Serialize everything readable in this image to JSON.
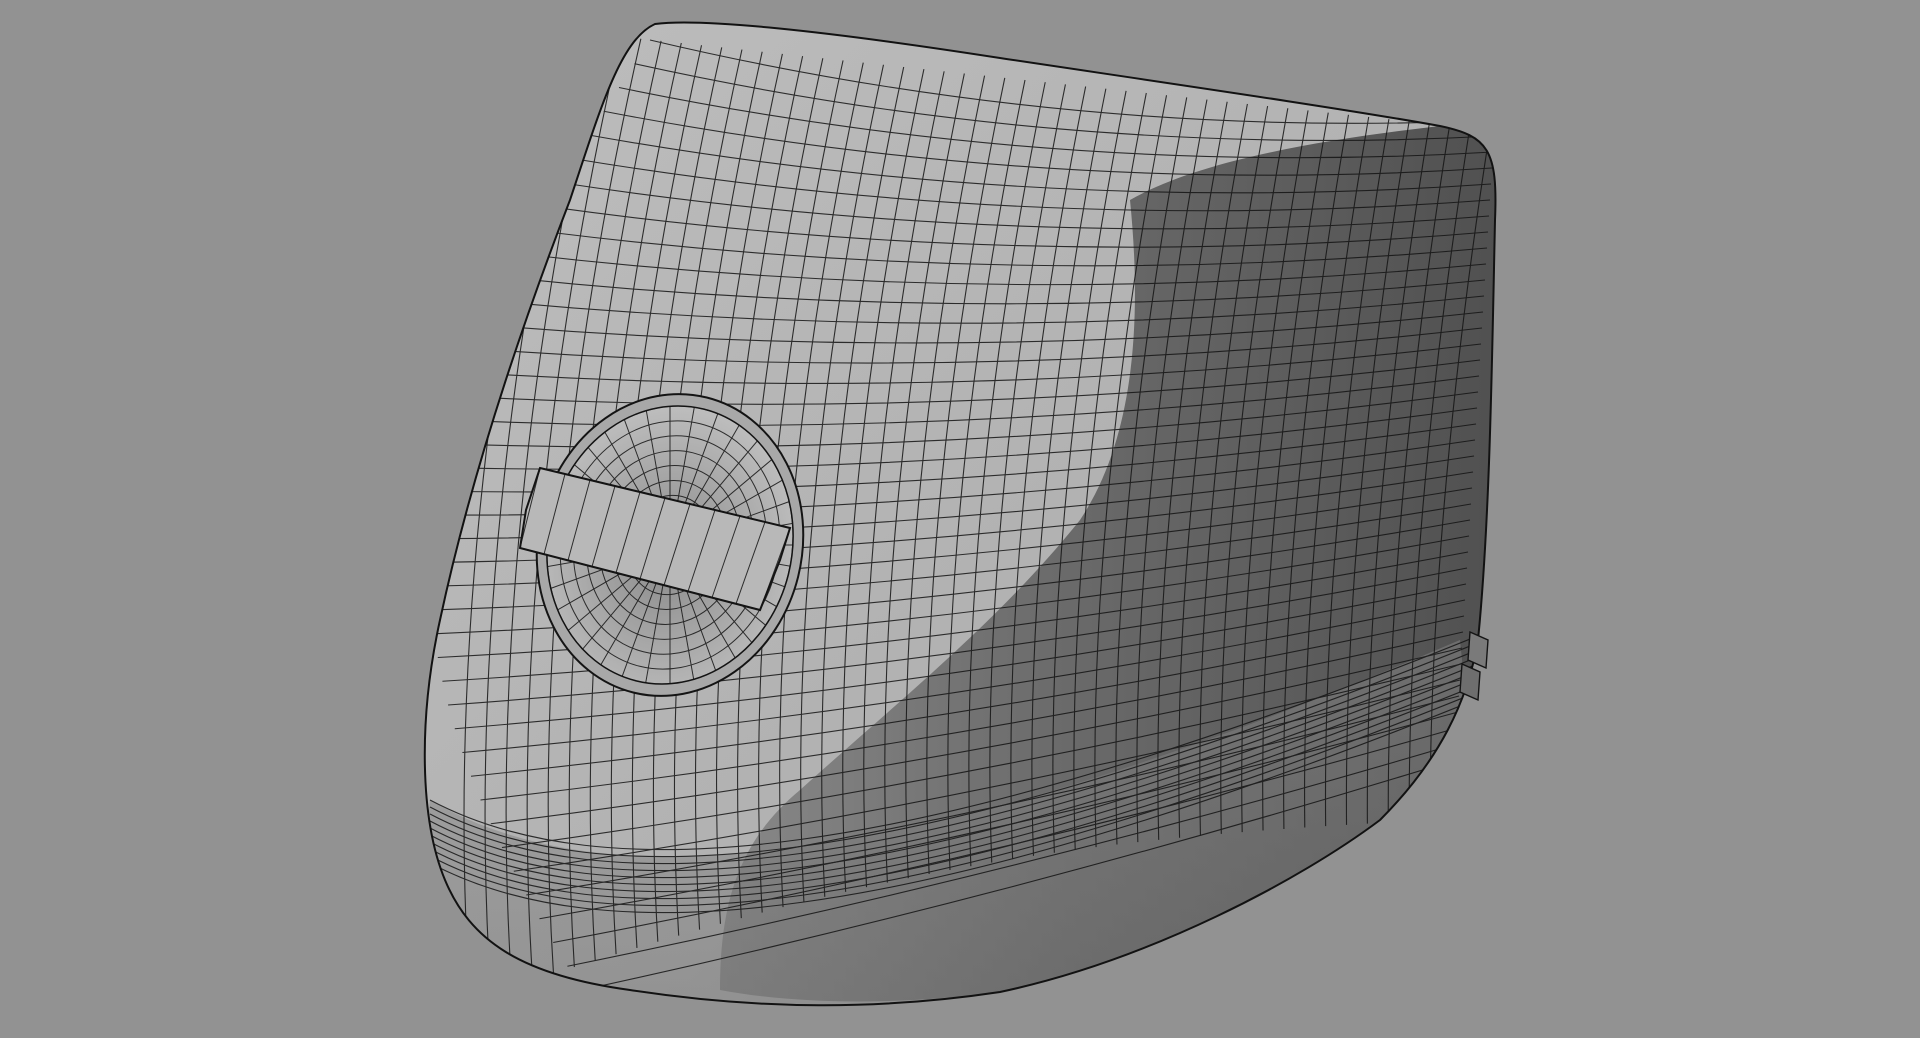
{
  "scene": {
    "description_kind": "3d-render",
    "background_color": "#929292",
    "surface_light_color": "#b9b9b9",
    "surface_mid_color": "#9d9d9d",
    "surface_dark_color": "#5a5a5a",
    "wire_color": "#141414",
    "object_icon": "wireframe-mesh-shell"
  }
}
